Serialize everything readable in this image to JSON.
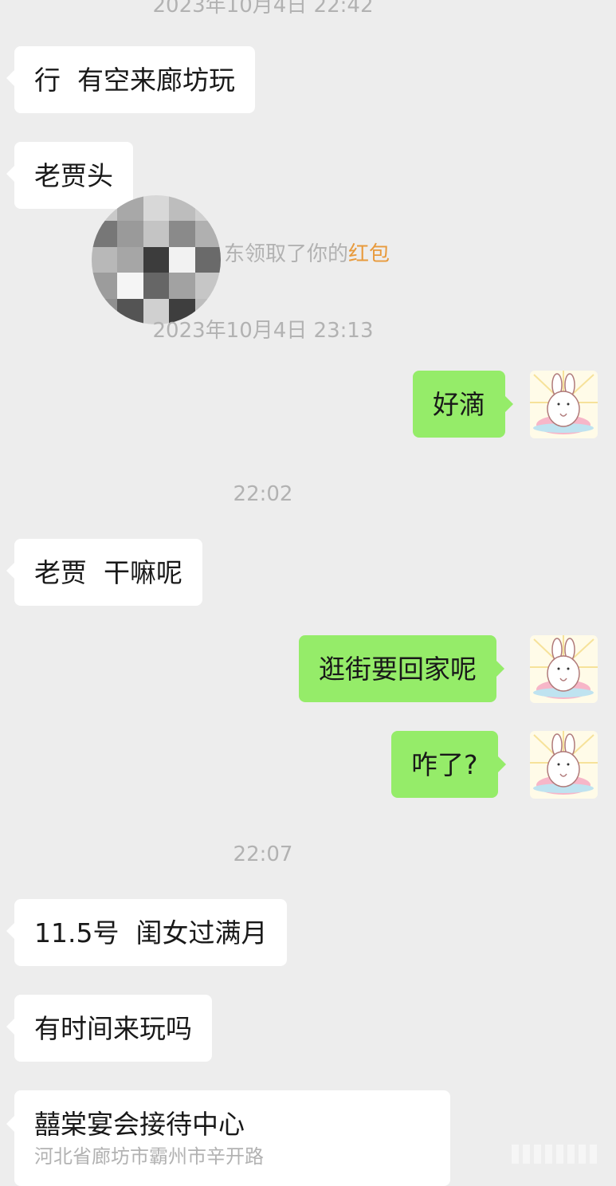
{
  "chat": {
    "top_timestamp": "2023年10月4日 22:42",
    "messages_1": {
      "in_1": "行  有空来廊坊玩",
      "in_2": "老贾头"
    },
    "system_notice": {
      "prefix": "东领取了你的",
      "highlight": "红包"
    },
    "timestamp_2": "2023年10月4日 23:13",
    "out_1": "好滴",
    "timestamp_3": "22:02",
    "in_3": "老贾  干嘛呢",
    "out_2": "逛街要回家呢",
    "out_3": "咋了?",
    "timestamp_4": "22:07",
    "in_4": "11.5号  闺女过满月",
    "in_5": "有时间来玩吗",
    "location_card": {
      "title": "囍棠宴会接待中心",
      "address": "河北省廊坊市霸州市辛开路"
    }
  },
  "icons": {
    "avatar": "rabbit-sticker-avatar-icon",
    "mosaic": "pixelated-avatar-icon"
  },
  "colors": {
    "background": "#ededed",
    "incoming_bubble": "#ffffff",
    "outgoing_bubble": "#95ec69",
    "timestamp_text": "#b2b2b2",
    "red_packet_highlight": "#e89a3c"
  }
}
